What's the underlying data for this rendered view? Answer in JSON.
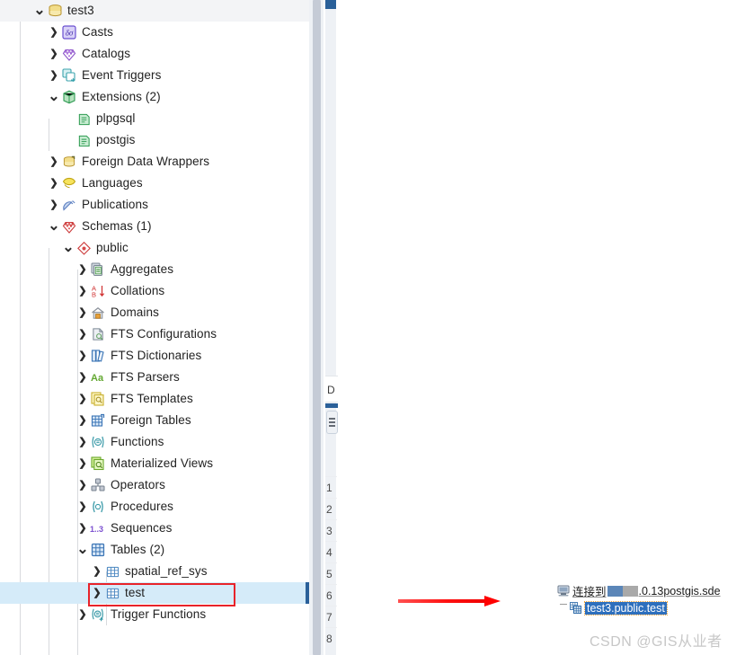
{
  "tree": {
    "panel_name": "pgadmin-object-browser",
    "rows": [
      {
        "label": "test3",
        "depth": 0,
        "caret": "down",
        "icon": "database-icon",
        "state": "root"
      },
      {
        "label": "Casts",
        "depth": 1,
        "caret": "right",
        "icon": "casts-icon",
        "state": "normal"
      },
      {
        "label": "Catalogs",
        "depth": 1,
        "caret": "right",
        "icon": "catalogs-icon",
        "state": "normal"
      },
      {
        "label": "Event Triggers",
        "depth": 1,
        "caret": "right",
        "icon": "event-triggers-icon",
        "state": "normal"
      },
      {
        "label": "Extensions (2)",
        "depth": 1,
        "caret": "down",
        "icon": "extensions-icon",
        "state": "normal"
      },
      {
        "label": "plpgsql",
        "depth": 2,
        "caret": "none",
        "icon": "extension-icon",
        "state": "normal"
      },
      {
        "label": "postgis",
        "depth": 2,
        "caret": "none",
        "icon": "extension-icon",
        "state": "normal"
      },
      {
        "label": "Foreign Data Wrappers",
        "depth": 1,
        "caret": "right",
        "icon": "foreign-data-wrapper-icon",
        "state": "normal"
      },
      {
        "label": "Languages",
        "depth": 1,
        "caret": "right",
        "icon": "languages-icon",
        "state": "normal"
      },
      {
        "label": "Publications",
        "depth": 1,
        "caret": "right",
        "icon": "publications-icon",
        "state": "normal"
      },
      {
        "label": "Schemas (1)",
        "depth": 1,
        "caret": "down",
        "icon": "schemas-icon",
        "state": "normal"
      },
      {
        "label": "public",
        "depth": 2,
        "caret": "down",
        "icon": "schema-icon",
        "state": "normal"
      },
      {
        "label": "Aggregates",
        "depth": 3,
        "caret": "right",
        "icon": "aggregates-icon",
        "state": "normal"
      },
      {
        "label": "Collations",
        "depth": 3,
        "caret": "right",
        "icon": "collations-icon",
        "state": "normal"
      },
      {
        "label": "Domains",
        "depth": 3,
        "caret": "right",
        "icon": "domains-icon",
        "state": "normal"
      },
      {
        "label": "FTS Configurations",
        "depth": 3,
        "caret": "right",
        "icon": "fts-configurations-icon",
        "state": "normal"
      },
      {
        "label": "FTS Dictionaries",
        "depth": 3,
        "caret": "right",
        "icon": "fts-dictionaries-icon",
        "state": "normal"
      },
      {
        "label": "FTS Parsers",
        "depth": 3,
        "caret": "right",
        "icon": "fts-parsers-icon",
        "state": "normal"
      },
      {
        "label": "FTS Templates",
        "depth": 3,
        "caret": "right",
        "icon": "fts-templates-icon",
        "state": "normal"
      },
      {
        "label": "Foreign Tables",
        "depth": 3,
        "caret": "right",
        "icon": "foreign-tables-icon",
        "state": "normal"
      },
      {
        "label": "Functions",
        "depth": 3,
        "caret": "right",
        "icon": "functions-icon",
        "state": "normal"
      },
      {
        "label": "Materialized Views",
        "depth": 3,
        "caret": "right",
        "icon": "materialized-views-icon",
        "state": "normal"
      },
      {
        "label": "Operators",
        "depth": 3,
        "caret": "right",
        "icon": "operators-icon",
        "state": "normal"
      },
      {
        "label": "Procedures",
        "depth": 3,
        "caret": "right",
        "icon": "procedures-icon",
        "state": "normal"
      },
      {
        "label": "Sequences",
        "depth": 3,
        "caret": "right",
        "icon": "sequences-icon",
        "state": "normal"
      },
      {
        "label": "Tables (2)",
        "depth": 3,
        "caret": "down",
        "icon": "tables-icon",
        "state": "normal"
      },
      {
        "label": "spatial_ref_sys",
        "depth": 4,
        "caret": "right",
        "icon": "table-icon",
        "state": "normal"
      },
      {
        "label": "test",
        "depth": 4,
        "caret": "right",
        "icon": "table-icon",
        "state": "selected"
      },
      {
        "label": "Trigger Functions",
        "depth": 3,
        "caret": "right",
        "icon": "trigger-functions-icon",
        "state": "normal"
      }
    ],
    "selected_row_label": "test",
    "highlight_color": "#e8232a",
    "selection_color": "#d5ebf9"
  },
  "grid": {
    "row_numbers": [
      "1",
      "2",
      "3",
      "4",
      "5",
      "6",
      "7",
      "8"
    ],
    "column_header_label": "D",
    "accent_color": "#2a6099"
  },
  "annotation": {
    "arrow_color": "#ff0000",
    "arrow_name": "red-pointer-arrow"
  },
  "callout": {
    "connection_prefix": "连接到",
    "connection_suffix": ".0.13postgis.sde",
    "selected_item": "test3.public.test"
  },
  "watermark": {
    "text": "CSDN @GIS从业者"
  }
}
